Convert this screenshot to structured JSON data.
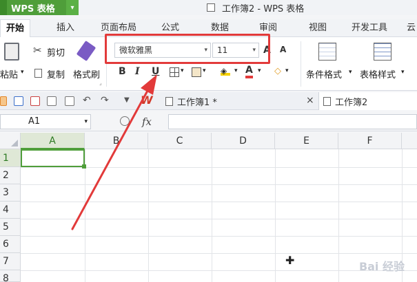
{
  "app": {
    "name": "WPS 表格",
    "window_title": "工作簿2 - WPS 表格"
  },
  "ribbon_tabs": [
    "开始",
    "插入",
    "页面布局",
    "公式",
    "数据",
    "审阅",
    "视图",
    "开发工具",
    "云"
  ],
  "clipboard": {
    "paste": "粘贴",
    "cut": "剪切",
    "copy": "复制",
    "format_painter": "格式刷"
  },
  "font": {
    "family": "微软雅黑",
    "size": "11",
    "bold": "B",
    "italic": "I",
    "underline": "U",
    "grow": "A",
    "shrink": "A",
    "color": "A"
  },
  "styles": {
    "conditional": "条件格式",
    "table_style": "表格样式"
  },
  "doc_tabs": [
    {
      "label": "工作簿1 *"
    },
    {
      "label": "工作簿2"
    }
  ],
  "formula_bar": {
    "cell_ref": "A1",
    "fx": "fx",
    "value": ""
  },
  "grid": {
    "columns": [
      "A",
      "B",
      "C",
      "D",
      "E",
      "F"
    ],
    "rows": [
      "1",
      "2",
      "3",
      "4",
      "5",
      "6",
      "7",
      "8"
    ],
    "active_cell": "A1"
  },
  "colors": {
    "accent": "#4f9e3a",
    "highlight": "#e23a3a"
  },
  "watermark": "Bai 经验"
}
